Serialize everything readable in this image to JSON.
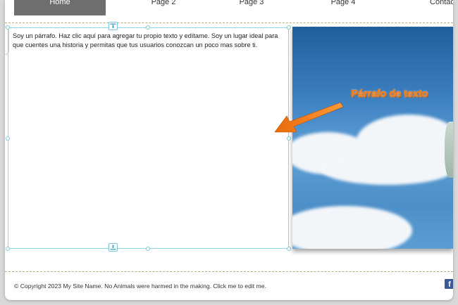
{
  "nav": {
    "items": [
      {
        "label": "Home",
        "active": true
      },
      {
        "label": "Page 2",
        "active": false
      },
      {
        "label": "Page 3",
        "active": false
      },
      {
        "label": "Page 4",
        "active": false
      },
      {
        "label": "Contact",
        "active": false
      }
    ]
  },
  "paragraph": {
    "text": "Soy un párrafo. Haz clic aquí para agregar tu propio texto y edítame. Soy un lugar ideal para que cuentes una historia y permitas que tus usuarios conozcan un poco mas sobre ti."
  },
  "annotation": {
    "label": "Párrafo de texto",
    "color": "#f47a12"
  },
  "footer": {
    "text": "© Copyright 2023 My Site Name. No Animals were harmed in the making. Click me to edit me.",
    "facebook_glyph": "f"
  },
  "colors": {
    "selection": "#8fd6e8",
    "nav_active": "#6e6e6e",
    "facebook": "#3b5998"
  },
  "icons": [
    "anchor-top-icon",
    "anchor-bottom-icon",
    "facebook-icon",
    "arrow-icon"
  ]
}
